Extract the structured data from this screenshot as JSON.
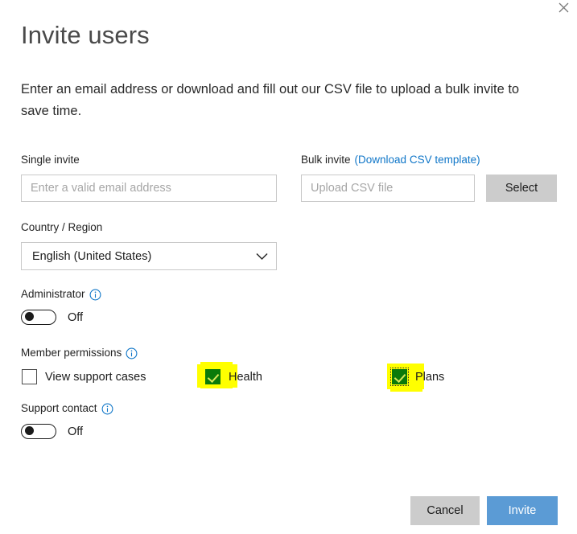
{
  "dialog": {
    "title": "Invite users",
    "description": "Enter an email address or download and fill out our CSV file to upload a bulk invite to save time.",
    "close_icon": "close-icon"
  },
  "single_invite": {
    "label": "Single invite",
    "placeholder": "Enter a valid email address",
    "value": ""
  },
  "bulk_invite": {
    "label": "Bulk invite",
    "link_label": "(Download CSV template)",
    "placeholder": "Upload CSV file",
    "value": "",
    "select_label": "Select"
  },
  "country": {
    "label": "Country / Region",
    "value": "English (United States)",
    "chevron_icon": "chevron-down-icon"
  },
  "administrator": {
    "label": "Administrator",
    "info_icon": "info-icon",
    "state": "Off",
    "checked": false
  },
  "member_permissions": {
    "label": "Member permissions",
    "info_icon": "info-icon",
    "options": [
      {
        "label": "View support cases",
        "checked": false,
        "highlighted": false,
        "focused": false
      },
      {
        "label": "Health",
        "checked": true,
        "highlighted": true,
        "focused": false
      },
      {
        "label": "Plans",
        "checked": true,
        "highlighted": true,
        "focused": true
      }
    ]
  },
  "support_contact": {
    "label": "Support contact",
    "info_icon": "info-icon",
    "state": "Off",
    "checked": false
  },
  "footer": {
    "cancel_label": "Cancel",
    "invite_label": "Invite"
  },
  "colors": {
    "link": "#0f76c8",
    "info": "#0f76c8",
    "primary_button": "#5b9bd5",
    "secondary_button": "#cccccc",
    "checkbox_checked": "#0a7a0a",
    "highlight": "#ffff00"
  }
}
